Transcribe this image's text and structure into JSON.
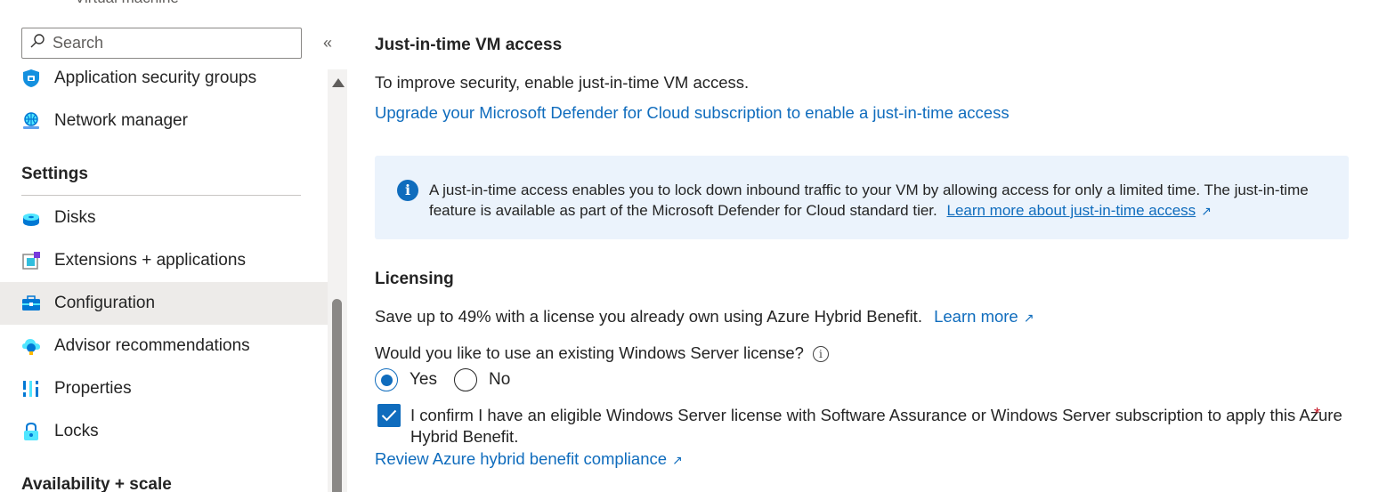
{
  "top_cut_text": "Virtual machine",
  "sidebar": {
    "search_placeholder": "Search",
    "collapse_glyph": "«",
    "items_top": [
      {
        "label": "Application security groups",
        "icon": "shield-icon"
      },
      {
        "label": "Network manager",
        "icon": "network-manager-icon"
      }
    ],
    "settings_header": "Settings",
    "settings_items": [
      {
        "label": "Disks",
        "icon": "disks-icon"
      },
      {
        "label": "Extensions + applications",
        "icon": "extensions-icon"
      },
      {
        "label": "Configuration",
        "icon": "configuration-icon",
        "selected": true
      },
      {
        "label": "Advisor recommendations",
        "icon": "advisor-icon"
      },
      {
        "label": "Properties",
        "icon": "properties-icon"
      },
      {
        "label": "Locks",
        "icon": "lock-icon"
      }
    ],
    "availability_header": "Availability + scale"
  },
  "jit": {
    "title": "Just-in-time VM access",
    "description": "To improve security, enable just-in-time VM access.",
    "upgrade_link": "Upgrade your Microsoft Defender for Cloud subscription to enable a just-in-time access",
    "info_text": "A just-in-time access enables you to lock down inbound traffic to your VM by allowing access for only a limited time. The just-in-time feature is available as part of the Microsoft Defender for Cloud standard tier.",
    "info_link": "Learn more about just-in-time access"
  },
  "licensing": {
    "title": "Licensing",
    "savings_text": "Save up to 49% with a license you already own using Azure Hybrid Benefit.",
    "learn_more": "Learn more",
    "question": "Would you like to use an existing Windows Server license?",
    "radio_yes": "Yes",
    "radio_no": "No",
    "selected": "Yes",
    "confirm_text": "I confirm I have an eligible Windows Server license with Software Assurance or Windows Server subscription to apply this Azure Hybrid Benefit.",
    "confirm_checked": true,
    "required_mark": "*",
    "compliance_link": "Review Azure hybrid benefit compliance"
  },
  "colors": {
    "accent": "#0f6cbd",
    "selected_bg": "#edebe9",
    "info_bg": "#ebf3fc",
    "required": "#c50f1f"
  }
}
